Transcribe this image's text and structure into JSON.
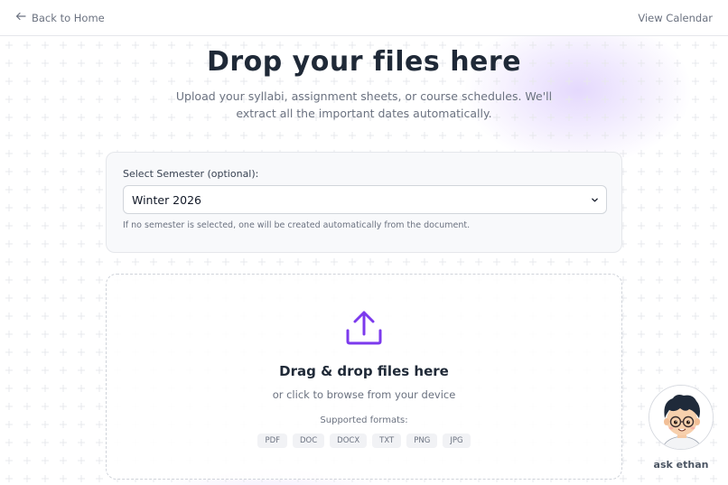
{
  "header": {
    "back_label": "Back to Home",
    "view_calendar_label": "View Calendar"
  },
  "hero": {
    "title": "Drop your files here",
    "subtitle": "Upload your syllabi, assignment sheets, or course schedules. We'll extract all the important dates automatically."
  },
  "semester": {
    "label": "Select Semester (optional):",
    "selected": "Winter 2026",
    "hint": "If no semester is selected, one will be created automatically from the document."
  },
  "dropzone": {
    "title": "Drag & drop files here",
    "subtitle": "or click to browse from your device",
    "formats_label": "Supported formats:",
    "formats": [
      "PDF",
      "DOC",
      "DOCX",
      "TXT",
      "PNG",
      "JPG"
    ]
  },
  "assistant": {
    "label": "ask ethan"
  },
  "colors": {
    "accent": "#7c3aed",
    "text": "#1f2937",
    "muted": "#6b7280"
  },
  "icons": {
    "back": "arrow-left-icon",
    "chevron": "chevron-down-icon",
    "upload": "upload-icon"
  }
}
